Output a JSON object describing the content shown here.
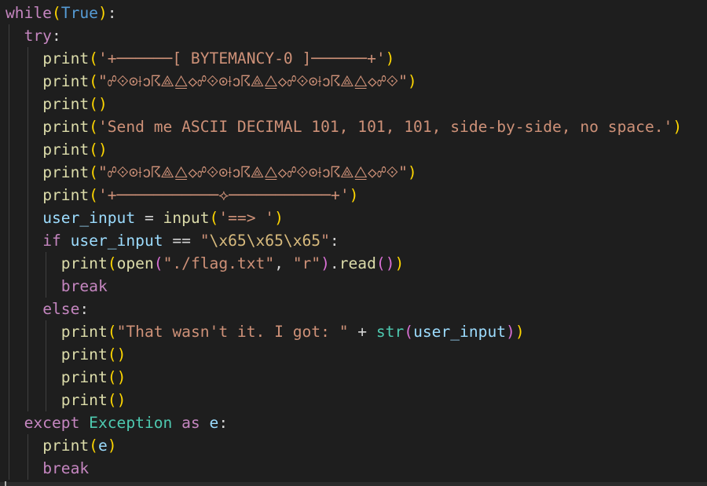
{
  "colors": {
    "background": "#1e1e1e",
    "control_keyword": "#c586c0",
    "function": "#dcdcaa",
    "variable": "#9cdcfe",
    "class": "#4ec9b0",
    "keyword": "#569cd6",
    "string": "#ce9178",
    "escape": "#d7ba7d",
    "bracket_level_1": "#ffd700",
    "bracket_level_2": "#da70d6",
    "bracket_level_3": "#179fff"
  },
  "code": {
    "lines": [
      {
        "indent": 0,
        "tokens": [
          {
            "t": "while",
            "k": "ctrl"
          },
          {
            "t": "(",
            "k": "b1"
          },
          {
            "t": "True",
            "k": "kw"
          },
          {
            "t": ")",
            "k": "b1"
          },
          {
            "t": ":",
            "k": "op"
          }
        ]
      },
      {
        "indent": 1,
        "tokens": [
          {
            "t": "try",
            "k": "ctrl"
          },
          {
            "t": ":",
            "k": "op"
          }
        ]
      },
      {
        "indent": 2,
        "tokens": [
          {
            "t": "print",
            "k": "fn"
          },
          {
            "t": "(",
            "k": "b1"
          },
          {
            "t": "'+──────[ BYTEMANCY-0 ]──────+'",
            "k": "str"
          },
          {
            "t": ")",
            "k": "b1"
          }
        ]
      },
      {
        "indent": 2,
        "tokens": [
          {
            "t": "print",
            "k": "fn"
          },
          {
            "t": "(",
            "k": "b1"
          },
          {
            "t": "\"☍⟐⊙⟊ↄ☈⟁⧋◇☍⟐⊙⟊ↄ☈⟁⧋◇☍⟐⊙⟊ↄ☈⟁⧋◇☍⟐\"",
            "k": "str"
          },
          {
            "t": ")",
            "k": "b1"
          }
        ]
      },
      {
        "indent": 2,
        "tokens": [
          {
            "t": "print",
            "k": "fn"
          },
          {
            "t": "(",
            "k": "b1"
          },
          {
            "t": ")",
            "k": "b1"
          }
        ]
      },
      {
        "indent": 2,
        "tokens": [
          {
            "t": "print",
            "k": "fn"
          },
          {
            "t": "(",
            "k": "b1"
          },
          {
            "t": "'Send me ASCII DECIMAL 101, 101, 101, side-by-side, no space.'",
            "k": "str"
          },
          {
            "t": ")",
            "k": "b1"
          }
        ]
      },
      {
        "indent": 2,
        "tokens": [
          {
            "t": "print",
            "k": "fn"
          },
          {
            "t": "(",
            "k": "b1"
          },
          {
            "t": ")",
            "k": "b1"
          }
        ]
      },
      {
        "indent": 2,
        "tokens": [
          {
            "t": "print",
            "k": "fn"
          },
          {
            "t": "(",
            "k": "b1"
          },
          {
            "t": "\"☍⟐⊙⟊ↄ☈⟁⧋◇☍⟐⊙⟊ↄ☈⟁⧋◇☍⟐⊙⟊ↄ☈⟁⧋◇☍⟐\"",
            "k": "str"
          },
          {
            "t": ")",
            "k": "b1"
          }
        ]
      },
      {
        "indent": 2,
        "tokens": [
          {
            "t": "print",
            "k": "fn"
          },
          {
            "t": "(",
            "k": "b1"
          },
          {
            "t": "'+───────────⟡───────────+'",
            "k": "str"
          },
          {
            "t": ")",
            "k": "b1"
          }
        ]
      },
      {
        "indent": 2,
        "tokens": [
          {
            "t": "user_input",
            "k": "var"
          },
          {
            "t": " = ",
            "k": "op"
          },
          {
            "t": "input",
            "k": "fn"
          },
          {
            "t": "(",
            "k": "b1"
          },
          {
            "t": "'==> '",
            "k": "str"
          },
          {
            "t": ")",
            "k": "b1"
          }
        ]
      },
      {
        "indent": 2,
        "tokens": [
          {
            "t": "if",
            "k": "ctrl"
          },
          {
            "t": " ",
            "k": "op"
          },
          {
            "t": "user_input",
            "k": "var"
          },
          {
            "t": " == ",
            "k": "op"
          },
          {
            "t": "\"",
            "k": "str"
          },
          {
            "t": "\\x65\\x65\\x65",
            "k": "esc"
          },
          {
            "t": "\"",
            "k": "str"
          },
          {
            "t": ":",
            "k": "op"
          }
        ]
      },
      {
        "indent": 3,
        "tokens": [
          {
            "t": "print",
            "k": "fn"
          },
          {
            "t": "(",
            "k": "b1"
          },
          {
            "t": "open",
            "k": "fn"
          },
          {
            "t": "(",
            "k": "b2"
          },
          {
            "t": "\"./flag.txt\"",
            "k": "str"
          },
          {
            "t": ", ",
            "k": "op"
          },
          {
            "t": "\"r\"",
            "k": "str"
          },
          {
            "t": ")",
            "k": "b2"
          },
          {
            "t": ".",
            "k": "op"
          },
          {
            "t": "read",
            "k": "fn"
          },
          {
            "t": "(",
            "k": "b2"
          },
          {
            "t": ")",
            "k": "b2"
          },
          {
            "t": ")",
            "k": "b1"
          }
        ]
      },
      {
        "indent": 3,
        "tokens": [
          {
            "t": "break",
            "k": "ctrl"
          }
        ]
      },
      {
        "indent": 2,
        "tokens": [
          {
            "t": "else",
            "k": "ctrl"
          },
          {
            "t": ":",
            "k": "op"
          }
        ]
      },
      {
        "indent": 3,
        "tokens": [
          {
            "t": "print",
            "k": "fn"
          },
          {
            "t": "(",
            "k": "b1"
          },
          {
            "t": "\"That wasn't it. I got: \"",
            "k": "str"
          },
          {
            "t": " + ",
            "k": "op"
          },
          {
            "t": "str",
            "k": "cls"
          },
          {
            "t": "(",
            "k": "b2"
          },
          {
            "t": "user_input",
            "k": "var"
          },
          {
            "t": ")",
            "k": "b2"
          },
          {
            "t": ")",
            "k": "b1"
          }
        ]
      },
      {
        "indent": 3,
        "tokens": [
          {
            "t": "print",
            "k": "fn"
          },
          {
            "t": "(",
            "k": "b1"
          },
          {
            "t": ")",
            "k": "b1"
          }
        ]
      },
      {
        "indent": 3,
        "tokens": [
          {
            "t": "print",
            "k": "fn"
          },
          {
            "t": "(",
            "k": "b1"
          },
          {
            "t": ")",
            "k": "b1"
          }
        ]
      },
      {
        "indent": 3,
        "tokens": [
          {
            "t": "print",
            "k": "fn"
          },
          {
            "t": "(",
            "k": "b1"
          },
          {
            "t": ")",
            "k": "b1"
          }
        ]
      },
      {
        "indent": 1,
        "tokens": [
          {
            "t": "except",
            "k": "ctrl"
          },
          {
            "t": " ",
            "k": "op"
          },
          {
            "t": "Exception",
            "k": "cls"
          },
          {
            "t": " ",
            "k": "op"
          },
          {
            "t": "as",
            "k": "ctrl"
          },
          {
            "t": " ",
            "k": "op"
          },
          {
            "t": "e",
            "k": "var"
          },
          {
            "t": ":",
            "k": "op"
          }
        ]
      },
      {
        "indent": 2,
        "tokens": [
          {
            "t": "print",
            "k": "fn"
          },
          {
            "t": "(",
            "k": "b1"
          },
          {
            "t": "e",
            "k": "var"
          },
          {
            "t": ")",
            "k": "b1"
          }
        ]
      },
      {
        "indent": 2,
        "tokens": [
          {
            "t": "break",
            "k": "ctrl"
          }
        ]
      }
    ]
  }
}
